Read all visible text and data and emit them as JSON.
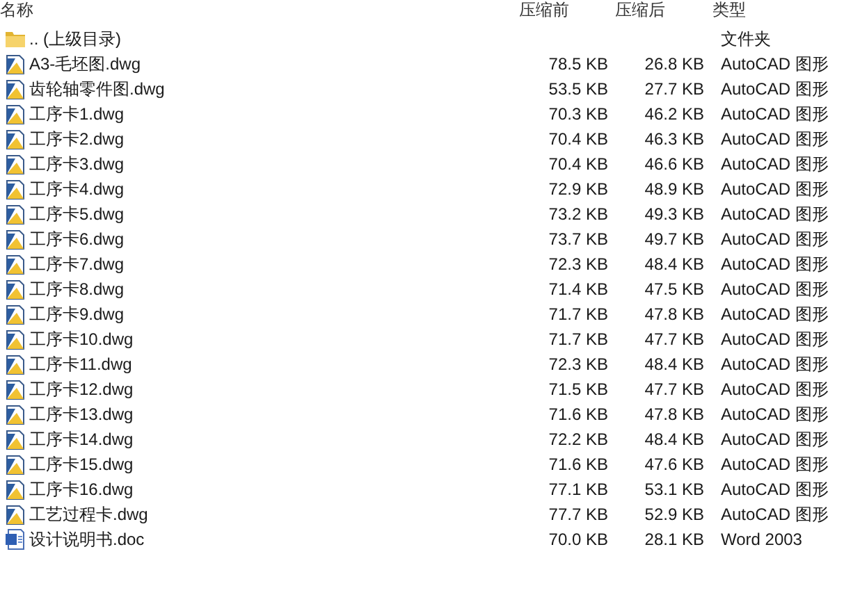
{
  "columns": [
    "名称",
    "压缩前",
    "压缩后",
    "类型"
  ],
  "rows": [
    {
      "kind": "folder",
      "name": ".. (上级目录)",
      "size": "",
      "packed": "",
      "type": "文件夹"
    },
    {
      "kind": "dwg",
      "name": "A3-毛坯图.dwg",
      "size": "78.5 KB",
      "packed": "26.8 KB",
      "type": "AutoCAD 图形"
    },
    {
      "kind": "dwg",
      "name": "齿轮轴零件图.dwg",
      "size": "53.5 KB",
      "packed": "27.7 KB",
      "type": "AutoCAD 图形"
    },
    {
      "kind": "dwg",
      "name": "工序卡1.dwg",
      "size": "70.3 KB",
      "packed": "46.2 KB",
      "type": "AutoCAD 图形"
    },
    {
      "kind": "dwg",
      "name": "工序卡2.dwg",
      "size": "70.4 KB",
      "packed": "46.3 KB",
      "type": "AutoCAD 图形"
    },
    {
      "kind": "dwg",
      "name": "工序卡3.dwg",
      "size": "70.4 KB",
      "packed": "46.6 KB",
      "type": "AutoCAD 图形"
    },
    {
      "kind": "dwg",
      "name": "工序卡4.dwg",
      "size": "72.9 KB",
      "packed": "48.9 KB",
      "type": "AutoCAD 图形"
    },
    {
      "kind": "dwg",
      "name": "工序卡5.dwg",
      "size": "73.2 KB",
      "packed": "49.3 KB",
      "type": "AutoCAD 图形"
    },
    {
      "kind": "dwg",
      "name": "工序卡6.dwg",
      "size": "73.7 KB",
      "packed": "49.7 KB",
      "type": "AutoCAD 图形"
    },
    {
      "kind": "dwg",
      "name": "工序卡7.dwg",
      "size": "72.3 KB",
      "packed": "48.4 KB",
      "type": "AutoCAD 图形"
    },
    {
      "kind": "dwg",
      "name": "工序卡8.dwg",
      "size": "71.4 KB",
      "packed": "47.5 KB",
      "type": "AutoCAD 图形"
    },
    {
      "kind": "dwg",
      "name": "工序卡9.dwg",
      "size": "71.7 KB",
      "packed": "47.8 KB",
      "type": "AutoCAD 图形"
    },
    {
      "kind": "dwg",
      "name": "工序卡10.dwg",
      "size": "71.7 KB",
      "packed": "47.7 KB",
      "type": "AutoCAD 图形"
    },
    {
      "kind": "dwg",
      "name": "工序卡11.dwg",
      "size": "72.3 KB",
      "packed": "48.4 KB",
      "type": "AutoCAD 图形"
    },
    {
      "kind": "dwg",
      "name": "工序卡12.dwg",
      "size": "71.5 KB",
      "packed": "47.7 KB",
      "type": "AutoCAD 图形"
    },
    {
      "kind": "dwg",
      "name": "工序卡13.dwg",
      "size": "71.6 KB",
      "packed": "47.8 KB",
      "type": "AutoCAD 图形"
    },
    {
      "kind": "dwg",
      "name": "工序卡14.dwg",
      "size": "72.2 KB",
      "packed": "48.4 KB",
      "type": "AutoCAD 图形"
    },
    {
      "kind": "dwg",
      "name": "工序卡15.dwg",
      "size": "71.6 KB",
      "packed": "47.6 KB",
      "type": "AutoCAD 图形"
    },
    {
      "kind": "dwg",
      "name": "工序卡16.dwg",
      "size": "77.1 KB",
      "packed": "53.1 KB",
      "type": "AutoCAD 图形"
    },
    {
      "kind": "dwg",
      "name": "工艺过程卡.dwg",
      "size": "77.7 KB",
      "packed": "52.9 KB",
      "type": "AutoCAD 图形"
    },
    {
      "kind": "doc",
      "name": "设计说明书.doc",
      "size": "70.0 KB",
      "packed": "28.1 KB",
      "type": "Word 2003"
    }
  ]
}
